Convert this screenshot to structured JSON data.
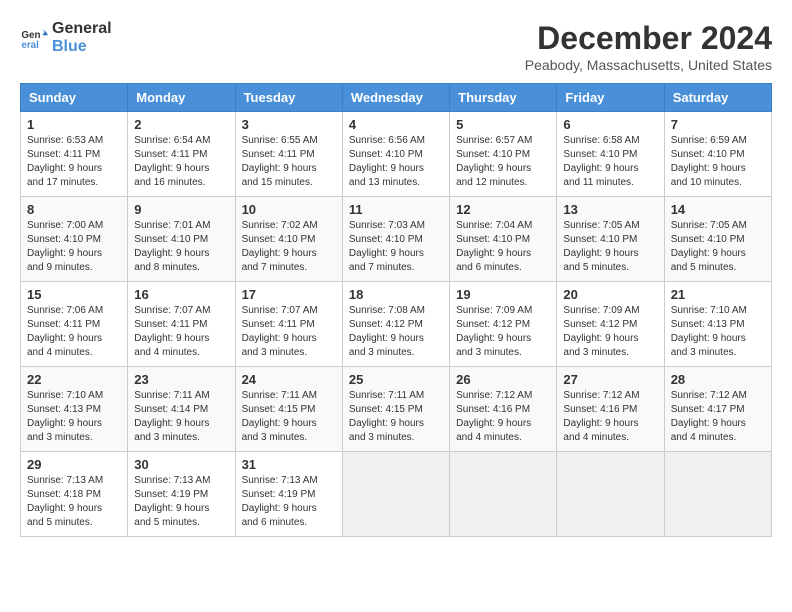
{
  "logo": {
    "line1": "General",
    "line2": "Blue"
  },
  "title": "December 2024",
  "location": "Peabody, Massachusetts, United States",
  "days_header": [
    "Sunday",
    "Monday",
    "Tuesday",
    "Wednesday",
    "Thursday",
    "Friday",
    "Saturday"
  ],
  "weeks": [
    [
      {
        "day": "1",
        "sunrise": "6:53 AM",
        "sunset": "4:11 PM",
        "daylight": "9 hours and 17 minutes."
      },
      {
        "day": "2",
        "sunrise": "6:54 AM",
        "sunset": "4:11 PM",
        "daylight": "9 hours and 16 minutes."
      },
      {
        "day": "3",
        "sunrise": "6:55 AM",
        "sunset": "4:11 PM",
        "daylight": "9 hours and 15 minutes."
      },
      {
        "day": "4",
        "sunrise": "6:56 AM",
        "sunset": "4:10 PM",
        "daylight": "9 hours and 13 minutes."
      },
      {
        "day": "5",
        "sunrise": "6:57 AM",
        "sunset": "4:10 PM",
        "daylight": "9 hours and 12 minutes."
      },
      {
        "day": "6",
        "sunrise": "6:58 AM",
        "sunset": "4:10 PM",
        "daylight": "9 hours and 11 minutes."
      },
      {
        "day": "7",
        "sunrise": "6:59 AM",
        "sunset": "4:10 PM",
        "daylight": "9 hours and 10 minutes."
      }
    ],
    [
      {
        "day": "8",
        "sunrise": "7:00 AM",
        "sunset": "4:10 PM",
        "daylight": "9 hours and 9 minutes."
      },
      {
        "day": "9",
        "sunrise": "7:01 AM",
        "sunset": "4:10 PM",
        "daylight": "9 hours and 8 minutes."
      },
      {
        "day": "10",
        "sunrise": "7:02 AM",
        "sunset": "4:10 PM",
        "daylight": "9 hours and 7 minutes."
      },
      {
        "day": "11",
        "sunrise": "7:03 AM",
        "sunset": "4:10 PM",
        "daylight": "9 hours and 7 minutes."
      },
      {
        "day": "12",
        "sunrise": "7:04 AM",
        "sunset": "4:10 PM",
        "daylight": "9 hours and 6 minutes."
      },
      {
        "day": "13",
        "sunrise": "7:05 AM",
        "sunset": "4:10 PM",
        "daylight": "9 hours and 5 minutes."
      },
      {
        "day": "14",
        "sunrise": "7:05 AM",
        "sunset": "4:10 PM",
        "daylight": "9 hours and 5 minutes."
      }
    ],
    [
      {
        "day": "15",
        "sunrise": "7:06 AM",
        "sunset": "4:11 PM",
        "daylight": "9 hours and 4 minutes."
      },
      {
        "day": "16",
        "sunrise": "7:07 AM",
        "sunset": "4:11 PM",
        "daylight": "9 hours and 4 minutes."
      },
      {
        "day": "17",
        "sunrise": "7:07 AM",
        "sunset": "4:11 PM",
        "daylight": "9 hours and 3 minutes."
      },
      {
        "day": "18",
        "sunrise": "7:08 AM",
        "sunset": "4:12 PM",
        "daylight": "9 hours and 3 minutes."
      },
      {
        "day": "19",
        "sunrise": "7:09 AM",
        "sunset": "4:12 PM",
        "daylight": "9 hours and 3 minutes."
      },
      {
        "day": "20",
        "sunrise": "7:09 AM",
        "sunset": "4:12 PM",
        "daylight": "9 hours and 3 minutes."
      },
      {
        "day": "21",
        "sunrise": "7:10 AM",
        "sunset": "4:13 PM",
        "daylight": "9 hours and 3 minutes."
      }
    ],
    [
      {
        "day": "22",
        "sunrise": "7:10 AM",
        "sunset": "4:13 PM",
        "daylight": "9 hours and 3 minutes."
      },
      {
        "day": "23",
        "sunrise": "7:11 AM",
        "sunset": "4:14 PM",
        "daylight": "9 hours and 3 minutes."
      },
      {
        "day": "24",
        "sunrise": "7:11 AM",
        "sunset": "4:15 PM",
        "daylight": "9 hours and 3 minutes."
      },
      {
        "day": "25",
        "sunrise": "7:11 AM",
        "sunset": "4:15 PM",
        "daylight": "9 hours and 3 minutes."
      },
      {
        "day": "26",
        "sunrise": "7:12 AM",
        "sunset": "4:16 PM",
        "daylight": "9 hours and 4 minutes."
      },
      {
        "day": "27",
        "sunrise": "7:12 AM",
        "sunset": "4:16 PM",
        "daylight": "9 hours and 4 minutes."
      },
      {
        "day": "28",
        "sunrise": "7:12 AM",
        "sunset": "4:17 PM",
        "daylight": "9 hours and 4 minutes."
      }
    ],
    [
      {
        "day": "29",
        "sunrise": "7:13 AM",
        "sunset": "4:18 PM",
        "daylight": "9 hours and 5 minutes."
      },
      {
        "day": "30",
        "sunrise": "7:13 AM",
        "sunset": "4:19 PM",
        "daylight": "9 hours and 5 minutes."
      },
      {
        "day": "31",
        "sunrise": "7:13 AM",
        "sunset": "4:19 PM",
        "daylight": "9 hours and 6 minutes."
      },
      null,
      null,
      null,
      null
    ]
  ]
}
